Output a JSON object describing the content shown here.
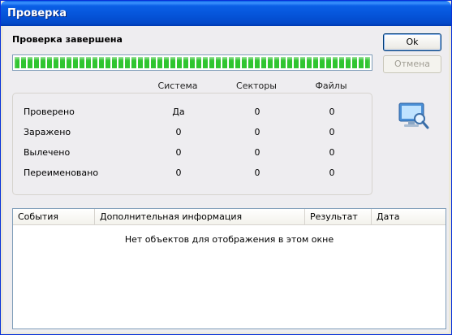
{
  "window": {
    "title": "Проверка"
  },
  "status": {
    "heading": "Проверка завершена",
    "progress_fraction": 1.0
  },
  "buttons": {
    "ok_label": "Ok",
    "cancel_label": "Отмена"
  },
  "stats": {
    "columns": [
      "Система",
      "Секторы",
      "Файлы"
    ],
    "rows": [
      {
        "label": "Проверено",
        "values": [
          "Да",
          "0",
          "0"
        ]
      },
      {
        "label": "Заражено",
        "values": [
          "0",
          "0",
          "0"
        ]
      },
      {
        "label": "Вылечено",
        "values": [
          "0",
          "0",
          "0"
        ]
      },
      {
        "label": "Переименовано",
        "values": [
          "0",
          "0",
          "0"
        ]
      }
    ]
  },
  "events_table": {
    "headers": [
      "События",
      "Дополнительная информация",
      "Результат",
      "Дата"
    ],
    "empty_message": "Нет объектов для отображения в этом окне"
  },
  "icons": {
    "scan_icon": "monitor-magnifier-icon"
  },
  "colors": {
    "progress": "#2fc52f",
    "titlebar": "#0553d8"
  }
}
